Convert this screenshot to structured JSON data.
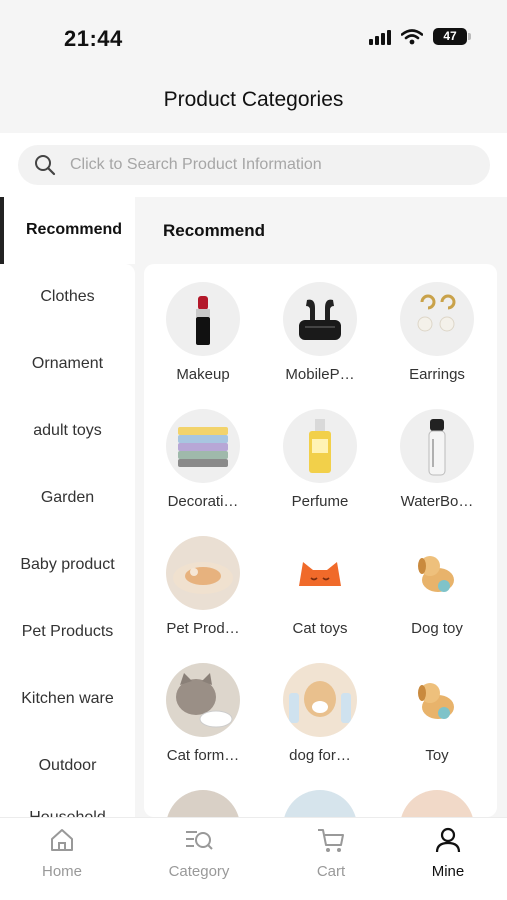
{
  "status_bar": {
    "time": "21:44",
    "battery": "47"
  },
  "header": {
    "title": "Product Categories"
  },
  "search": {
    "placeholder": "Click to Search Product Information"
  },
  "sidebar": {
    "active": "Recommend",
    "items": [
      "Clothes",
      "Ornament",
      "adult toys",
      "Garden",
      "Baby product",
      "Pet Products",
      "Kitchen ware",
      "Outdoor",
      "Household"
    ]
  },
  "main": {
    "heading": "Recommend",
    "categories": [
      {
        "label": "Makeup",
        "icon": "lipstick-icon"
      },
      {
        "label": "MobileP…",
        "icon": "earbuds-icon"
      },
      {
        "label": "Earrings",
        "icon": "earrings-icon"
      },
      {
        "label": "Decorati…",
        "icon": "towels-icon"
      },
      {
        "label": "Perfume",
        "icon": "perfume-icon"
      },
      {
        "label": "WaterBo…",
        "icon": "water-bottle-icon"
      },
      {
        "label": "Pet Prod…",
        "icon": "pet-bed-icon"
      },
      {
        "label": "Cat toys",
        "icon": "cat-toy-icon"
      },
      {
        "label": "Dog toy",
        "icon": "dog-toy-icon"
      },
      {
        "label": "Cat form…",
        "icon": "cat-photo-icon"
      },
      {
        "label": "dog for…",
        "icon": "dog-photo-icon"
      },
      {
        "label": "Toy",
        "icon": "toy-icon"
      }
    ]
  },
  "tab_bar": {
    "items": [
      {
        "label": "Home",
        "icon": "home-icon"
      },
      {
        "label": "Category",
        "icon": "category-search-icon"
      },
      {
        "label": "Cart",
        "icon": "cart-icon"
      },
      {
        "label": "Mine",
        "icon": "user-icon"
      }
    ],
    "active": "Mine"
  },
  "colors": {
    "background": "#f5f5f5",
    "active_text": "#111111",
    "inactive_text": "#999999",
    "accent_orange": "#f06a2a"
  }
}
